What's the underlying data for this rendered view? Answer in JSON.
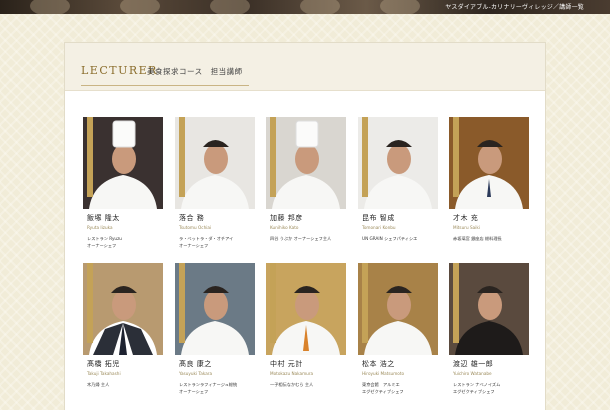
{
  "header": {
    "breadcrumb": "ヤスダイアブル-カリナリーヴィレッジ／講師一覧"
  },
  "section": {
    "title": "LECTURER",
    "subtitle": "美食探求コース　担当講師"
  },
  "lecturers": [
    {
      "name": "飯塚 隆太",
      "romaji": "Ryuta Iizuka",
      "affiliation": [
        "レストラン Ryuzu",
        "オーナーシェフ"
      ],
      "hat": true,
      "uniform": "white",
      "bg": "#3a3130"
    },
    {
      "name": "落合 務",
      "romaji": "Tsutomu Ochiai",
      "affiliation": [
        "ラ・ベットラ・ダ・オチアイ",
        "オーナーシェフ"
      ],
      "hat": false,
      "uniform": "white",
      "bg": "#e8e6e2"
    },
    {
      "name": "加藤 邦彦",
      "romaji": "Kunihiko Kato",
      "affiliation": [
        "四谷 うぶか  オーナーシェフ主人"
      ],
      "hat": true,
      "uniform": "white",
      "bg": "#d9d6d0"
    },
    {
      "name": "昆布 智成",
      "romaji": "Tomonari Konbu",
      "affiliation": [
        "UN GRAIN シェフパティシエ"
      ],
      "hat": false,
      "uniform": "white",
      "bg": "#ecebe8"
    },
    {
      "name": "才木 充",
      "romaji": "Mitsuru Saiki",
      "affiliation": [
        "赤坂璃宮 銀座店 総料理長"
      ],
      "hat": false,
      "uniform": "whitetie",
      "bg": "#8a5a2a"
    },
    {
      "name": "髙橋 拓児",
      "romaji": "Takuji Takahashi",
      "affiliation": [
        "木乃婦 主人"
      ],
      "hat": false,
      "uniform": "suit",
      "bg": "#b89a70"
    },
    {
      "name": "髙良 康之",
      "romaji": "Yasuyuki Takara",
      "affiliation": [
        "レストランラフィナージュ総統",
        "オーナーシェフ"
      ],
      "hat": false,
      "uniform": "white",
      "bg": "#6b7a86"
    },
    {
      "name": "中村 元計",
      "romaji": "Motokazu Nakamura",
      "affiliation": [
        "一子相伝なかむら 主人"
      ],
      "hat": false,
      "uniform": "whiteorange",
      "bg": "#c8a45e"
    },
    {
      "name": "松本 浩之",
      "romaji": "Hiroyuki Matsumoto",
      "affiliation": [
        "東京会館　アルミエ",
        "エグゼクティブシェフ"
      ],
      "hat": false,
      "uniform": "white",
      "bg": "#a88248"
    },
    {
      "name": "渡辺 雄一郎",
      "romaji": "Yuichiro Watanabe",
      "affiliation": [
        "レストラン ナベノイズム",
        "エグゼクティブシェフ"
      ],
      "hat": false,
      "uniform": "black",
      "bg": "#5a4a3e"
    }
  ],
  "colors": {
    "accent_gold": "#c4a257",
    "title_gold": "#8a6d2c",
    "page_bg": "#f1ecd8"
  }
}
